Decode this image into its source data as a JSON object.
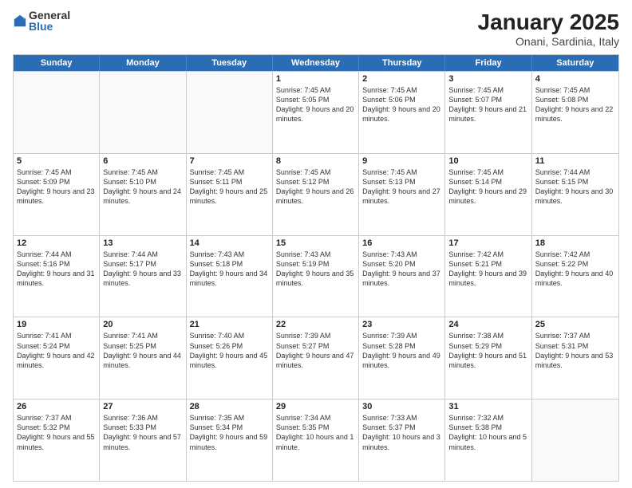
{
  "logo": {
    "general": "General",
    "blue": "Blue"
  },
  "title": "January 2025",
  "subtitle": "Onani, Sardinia, Italy",
  "days": [
    "Sunday",
    "Monday",
    "Tuesday",
    "Wednesday",
    "Thursday",
    "Friday",
    "Saturday"
  ],
  "rows": [
    [
      {
        "day": "",
        "text": "",
        "empty": true
      },
      {
        "day": "",
        "text": "",
        "empty": true
      },
      {
        "day": "",
        "text": "",
        "empty": true
      },
      {
        "day": "1",
        "text": "Sunrise: 7:45 AM\nSunset: 5:05 PM\nDaylight: 9 hours and 20 minutes."
      },
      {
        "day": "2",
        "text": "Sunrise: 7:45 AM\nSunset: 5:06 PM\nDaylight: 9 hours and 20 minutes."
      },
      {
        "day": "3",
        "text": "Sunrise: 7:45 AM\nSunset: 5:07 PM\nDaylight: 9 hours and 21 minutes."
      },
      {
        "day": "4",
        "text": "Sunrise: 7:45 AM\nSunset: 5:08 PM\nDaylight: 9 hours and 22 minutes."
      }
    ],
    [
      {
        "day": "5",
        "text": "Sunrise: 7:45 AM\nSunset: 5:09 PM\nDaylight: 9 hours and 23 minutes."
      },
      {
        "day": "6",
        "text": "Sunrise: 7:45 AM\nSunset: 5:10 PM\nDaylight: 9 hours and 24 minutes."
      },
      {
        "day": "7",
        "text": "Sunrise: 7:45 AM\nSunset: 5:11 PM\nDaylight: 9 hours and 25 minutes."
      },
      {
        "day": "8",
        "text": "Sunrise: 7:45 AM\nSunset: 5:12 PM\nDaylight: 9 hours and 26 minutes."
      },
      {
        "day": "9",
        "text": "Sunrise: 7:45 AM\nSunset: 5:13 PM\nDaylight: 9 hours and 27 minutes."
      },
      {
        "day": "10",
        "text": "Sunrise: 7:45 AM\nSunset: 5:14 PM\nDaylight: 9 hours and 29 minutes."
      },
      {
        "day": "11",
        "text": "Sunrise: 7:44 AM\nSunset: 5:15 PM\nDaylight: 9 hours and 30 minutes."
      }
    ],
    [
      {
        "day": "12",
        "text": "Sunrise: 7:44 AM\nSunset: 5:16 PM\nDaylight: 9 hours and 31 minutes."
      },
      {
        "day": "13",
        "text": "Sunrise: 7:44 AM\nSunset: 5:17 PM\nDaylight: 9 hours and 33 minutes."
      },
      {
        "day": "14",
        "text": "Sunrise: 7:43 AM\nSunset: 5:18 PM\nDaylight: 9 hours and 34 minutes."
      },
      {
        "day": "15",
        "text": "Sunrise: 7:43 AM\nSunset: 5:19 PM\nDaylight: 9 hours and 35 minutes."
      },
      {
        "day": "16",
        "text": "Sunrise: 7:43 AM\nSunset: 5:20 PM\nDaylight: 9 hours and 37 minutes."
      },
      {
        "day": "17",
        "text": "Sunrise: 7:42 AM\nSunset: 5:21 PM\nDaylight: 9 hours and 39 minutes."
      },
      {
        "day": "18",
        "text": "Sunrise: 7:42 AM\nSunset: 5:22 PM\nDaylight: 9 hours and 40 minutes."
      }
    ],
    [
      {
        "day": "19",
        "text": "Sunrise: 7:41 AM\nSunset: 5:24 PM\nDaylight: 9 hours and 42 minutes."
      },
      {
        "day": "20",
        "text": "Sunrise: 7:41 AM\nSunset: 5:25 PM\nDaylight: 9 hours and 44 minutes."
      },
      {
        "day": "21",
        "text": "Sunrise: 7:40 AM\nSunset: 5:26 PM\nDaylight: 9 hours and 45 minutes."
      },
      {
        "day": "22",
        "text": "Sunrise: 7:39 AM\nSunset: 5:27 PM\nDaylight: 9 hours and 47 minutes."
      },
      {
        "day": "23",
        "text": "Sunrise: 7:39 AM\nSunset: 5:28 PM\nDaylight: 9 hours and 49 minutes."
      },
      {
        "day": "24",
        "text": "Sunrise: 7:38 AM\nSunset: 5:29 PM\nDaylight: 9 hours and 51 minutes."
      },
      {
        "day": "25",
        "text": "Sunrise: 7:37 AM\nSunset: 5:31 PM\nDaylight: 9 hours and 53 minutes."
      }
    ],
    [
      {
        "day": "26",
        "text": "Sunrise: 7:37 AM\nSunset: 5:32 PM\nDaylight: 9 hours and 55 minutes."
      },
      {
        "day": "27",
        "text": "Sunrise: 7:36 AM\nSunset: 5:33 PM\nDaylight: 9 hours and 57 minutes."
      },
      {
        "day": "28",
        "text": "Sunrise: 7:35 AM\nSunset: 5:34 PM\nDaylight: 9 hours and 59 minutes."
      },
      {
        "day": "29",
        "text": "Sunrise: 7:34 AM\nSunset: 5:35 PM\nDaylight: 10 hours and 1 minute."
      },
      {
        "day": "30",
        "text": "Sunrise: 7:33 AM\nSunset: 5:37 PM\nDaylight: 10 hours and 3 minutes."
      },
      {
        "day": "31",
        "text": "Sunrise: 7:32 AM\nSunset: 5:38 PM\nDaylight: 10 hours and 5 minutes."
      },
      {
        "day": "",
        "text": "",
        "empty": true
      }
    ]
  ]
}
